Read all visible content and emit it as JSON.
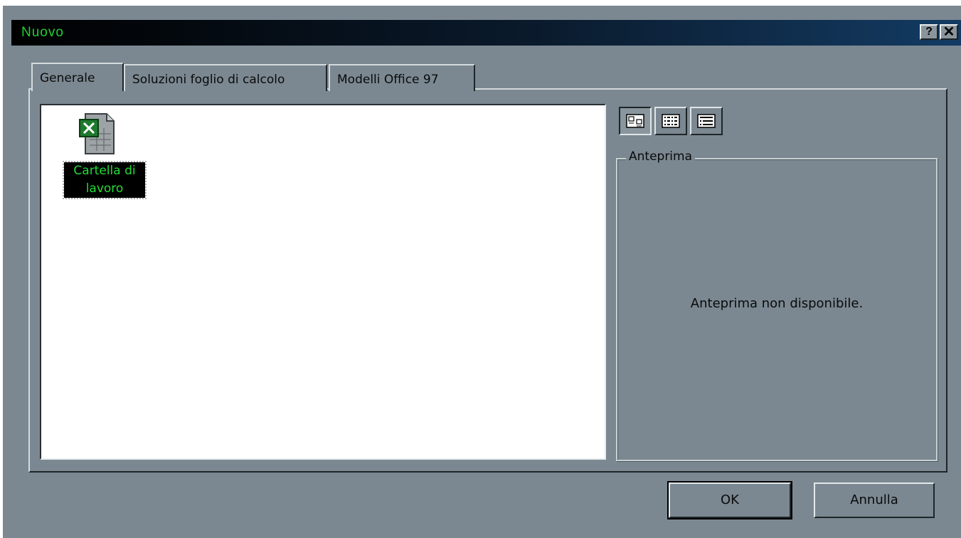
{
  "window": {
    "title": "Nuovo",
    "help_glyph": "?",
    "close_glyph": "✕"
  },
  "tabs": [
    {
      "label": "Generale",
      "selected": true
    },
    {
      "label": "Soluzioni foglio di calcolo",
      "selected": false
    },
    {
      "label": "Modelli Office 97",
      "selected": false
    }
  ],
  "file_list": {
    "items": [
      {
        "label_line1": "Cartella di",
        "label_line2": "lavoro",
        "icon": "excel-workbook-icon",
        "selected": true
      }
    ]
  },
  "view_modes": {
    "selected": "large-icons",
    "icons": [
      "large-icons-view-icon",
      "list-view-icon",
      "details-view-icon"
    ]
  },
  "preview": {
    "title": "Anteprima",
    "message": "Anteprima non disponibile."
  },
  "buttons": {
    "ok": "OK",
    "cancel": "Annulla"
  },
  "colors": {
    "dialog_bg": "#7b8891",
    "title_text": "#20d030",
    "selection_bg": "#000000",
    "selection_text": "#22dd33"
  }
}
